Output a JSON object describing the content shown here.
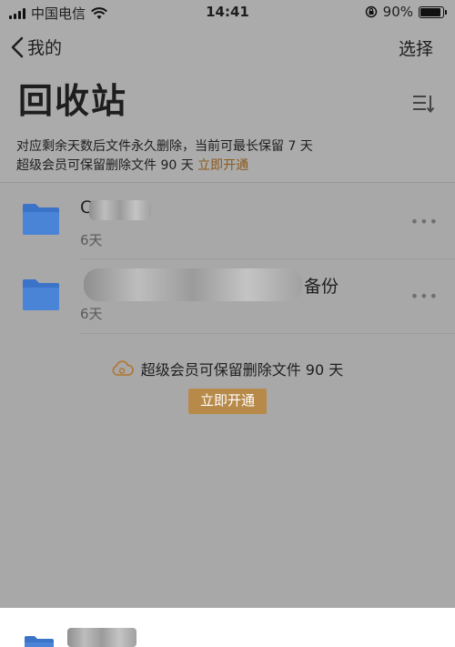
{
  "status_bar": {
    "carrier": "中国电信",
    "time": "14:41",
    "battery_percent": "90%",
    "battery_level": 0.9
  },
  "nav": {
    "back_label": "我的",
    "select_label": "选择"
  },
  "page": {
    "title": "回收站"
  },
  "notice": {
    "line1": "对应剩余天数后文件永久删除，当前可最长保留 7 天",
    "line2_text": "超级会员可保留删除文件 90 天",
    "line2_link": "立即开通"
  },
  "files": [
    {
      "name": "C",
      "days_left": "6天"
    },
    {
      "name": "备份",
      "days_left": "6天"
    }
  ],
  "promo": {
    "text": "超级会员可保留删除文件 90 天",
    "button": "立即开通"
  },
  "colors": {
    "folder": "#3a73c8",
    "accent": "#b88a4a",
    "overlay": "#ababab"
  },
  "icons": [
    "signal-icon",
    "wifi-icon",
    "rotation-lock-icon",
    "battery-icon",
    "back-chevron-icon",
    "sort-icon",
    "folder-icon",
    "more-icon",
    "cloud-icon"
  ]
}
